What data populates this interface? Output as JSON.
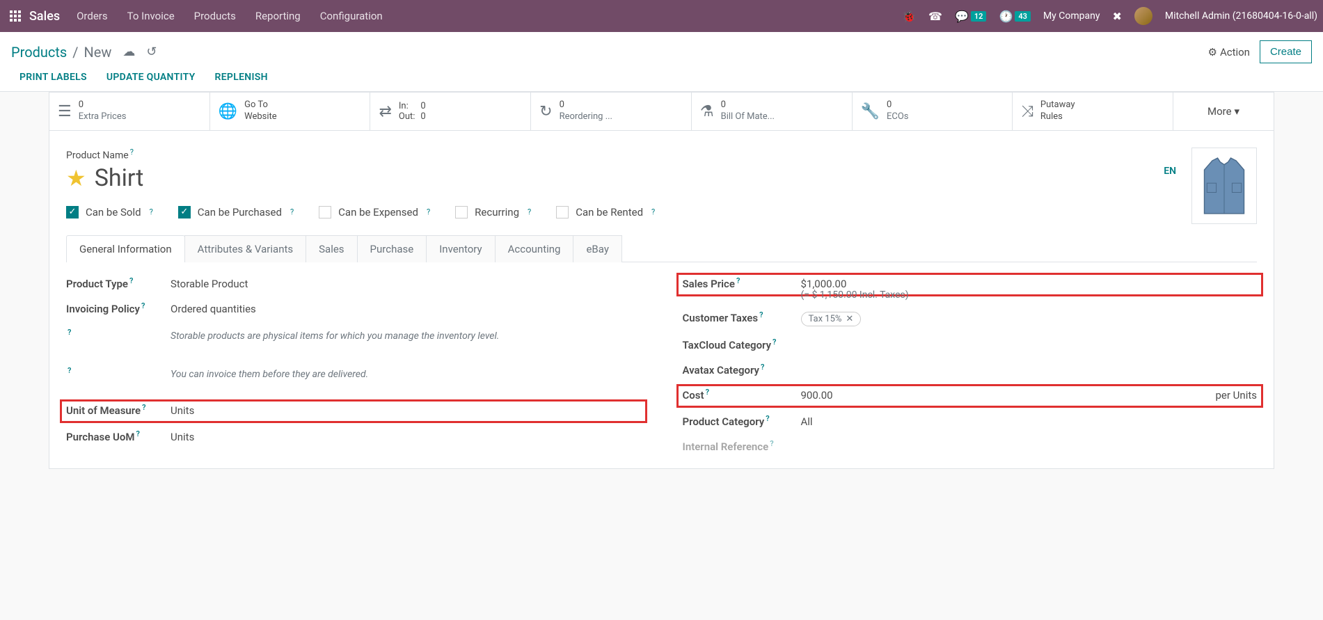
{
  "topbar": {
    "brand": "Sales",
    "nav": [
      "Orders",
      "To Invoice",
      "Products",
      "Reporting",
      "Configuration"
    ],
    "msg_count": "12",
    "activity_count": "43",
    "company": "My Company",
    "user": "Mitchell Admin (21680404-16-0-all)"
  },
  "cp": {
    "breadcrumb_link": "Products",
    "breadcrumb_current": "New",
    "action": "Action",
    "create": "Create",
    "buttons": [
      "PRINT LABELS",
      "UPDATE QUANTITY",
      "REPLENISH"
    ]
  },
  "stats": {
    "extra_prices": {
      "val": "0",
      "label": "Extra Prices"
    },
    "website": {
      "l1": "Go To",
      "l2": "Website"
    },
    "inout": {
      "in_l": "In:",
      "in_v": "0",
      "out_l": "Out:",
      "out_v": "0"
    },
    "reorder": {
      "val": "0",
      "label": "Reordering ..."
    },
    "bom": {
      "val": "0",
      "label": "Bill Of Mate..."
    },
    "ecos": {
      "val": "0",
      "label": "ECOs"
    },
    "putaway": {
      "l1": "Putaway",
      "l2": "Rules"
    },
    "more": "More"
  },
  "product": {
    "name_label": "Product Name",
    "name": "Shirt",
    "lang": "EN",
    "opts": {
      "sold": "Can be Sold",
      "purchased": "Can be Purchased",
      "expensed": "Can be Expensed",
      "recurring": "Recurring",
      "rented": "Can be Rented"
    }
  },
  "tabs": [
    "General Information",
    "Attributes & Variants",
    "Sales",
    "Purchase",
    "Inventory",
    "Accounting",
    "eBay"
  ],
  "fields": {
    "product_type": {
      "label": "Product Type",
      "value": "Storable Product"
    },
    "invoicing": {
      "label": "Invoicing Policy",
      "value": "Ordered quantities"
    },
    "help1": "Storable products are physical items for which you manage the inventory level.",
    "help2": "You can invoice them before they are delivered.",
    "uom": {
      "label": "Unit of Measure",
      "value": "Units"
    },
    "purchase_uom": {
      "label": "Purchase UoM",
      "value": "Units"
    },
    "sales_price": {
      "label": "Sales Price",
      "value": "$1,000.00"
    },
    "incl_taxes": "(= $ 1,150.00 Incl. Taxes)",
    "customer_taxes": {
      "label": "Customer Taxes",
      "tag": "Tax 15%"
    },
    "taxcloud": {
      "label": "TaxCloud Category"
    },
    "avatax": {
      "label": "Avatax Category"
    },
    "cost": {
      "label": "Cost",
      "value": "900.00",
      "unit": "per Units"
    },
    "category": {
      "label": "Product Category",
      "value": "All"
    },
    "internal_ref": {
      "label": "Internal Reference"
    }
  }
}
